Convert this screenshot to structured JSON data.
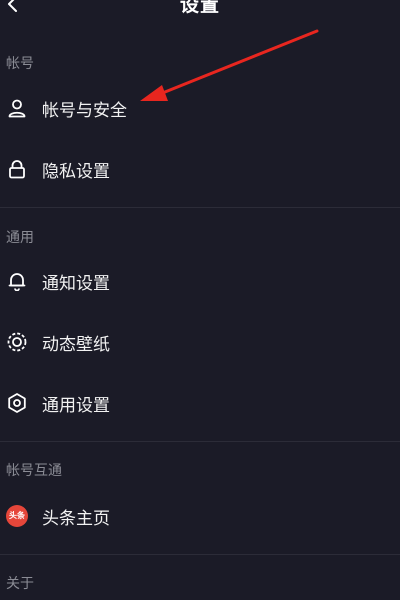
{
  "header": {
    "title": "设置",
    "back_icon": "chevron-left-icon"
  },
  "sections": [
    {
      "label": "帐号",
      "items": [
        {
          "label": "帐号与安全",
          "icon": "user-icon"
        },
        {
          "label": "隐私设置",
          "icon": "lock-icon"
        }
      ]
    },
    {
      "label": "通用",
      "items": [
        {
          "label": "通知设置",
          "icon": "bell-icon"
        },
        {
          "label": "动态壁纸",
          "icon": "wallpaper-icon"
        },
        {
          "label": "通用设置",
          "icon": "gear-icon"
        }
      ]
    },
    {
      "label": "帐号互通",
      "items": [
        {
          "label": "头条主页",
          "icon": "toutiao-logo-icon",
          "badge_text": "头条"
        }
      ]
    },
    {
      "label": "关于",
      "items": []
    }
  ],
  "colors": {
    "background": "#1b1b27",
    "section_text": "#8b8c95",
    "item_text": "#f2f2f2",
    "divider": "#2c2c38",
    "annotation_arrow": "#e8261f",
    "toutiao_badge": "#e5463a"
  }
}
